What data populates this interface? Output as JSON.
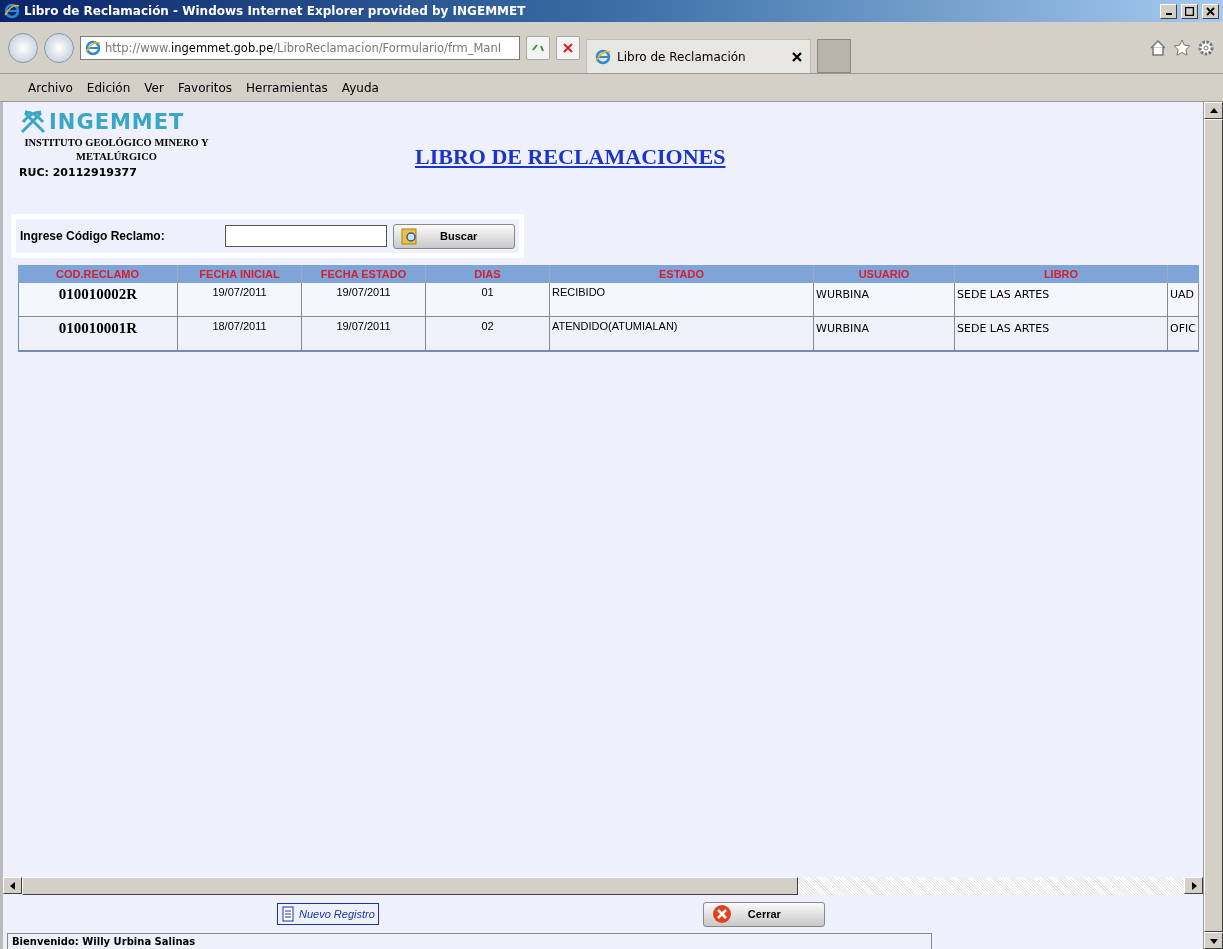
{
  "window": {
    "title": "Libro de Reclamación - Windows Internet Explorer provided by INGEMMET"
  },
  "address_bar": {
    "url_prefix": "http://www.",
    "url_domain": "ingemmet.gob.pe",
    "url_path": "/LibroReclamacion/Formulario/frm_ManI"
  },
  "tabs": [
    {
      "label": "Libro de Reclamación",
      "selected": true
    }
  ],
  "menu": [
    "Archivo",
    "Edición",
    "Ver",
    "Favoritos",
    "Herramientas",
    "Ayuda"
  ],
  "header": {
    "logo": "INGEMMET",
    "institute": "INSTITUTO GEOLÓGICO MINERO Y METALÚRGICO",
    "ruc": "RUC: 20112919377",
    "title": "LIBRO DE RECLAMACIONES"
  },
  "search": {
    "label": "Ingrese Código Reclamo:",
    "button": "Buscar"
  },
  "table": {
    "columns": [
      "COD.RECLAMO",
      "FECHA INICIAL",
      "FECHA ESTADO",
      "DIAS",
      "ESTADO",
      "USUARIO",
      "LIBRO"
    ],
    "rows": [
      [
        "010010002R",
        "19/07/2011",
        "19/07/2011",
        "01",
        "RECIBIDO",
        "WURBINA",
        "SEDE LAS ARTES",
        "UAD"
      ],
      [
        "010010001R",
        "18/07/2011",
        "19/07/2011",
        "02",
        "ATENDIDO(ATUMIALAN)",
        "WURBINA",
        "SEDE LAS ARTES",
        "OFIC"
      ]
    ]
  },
  "footer": {
    "new_button": "Nuevo Registro",
    "close_button": "Cerrar",
    "welcome": "Bienvenido: Willy Urbina Salinas"
  }
}
